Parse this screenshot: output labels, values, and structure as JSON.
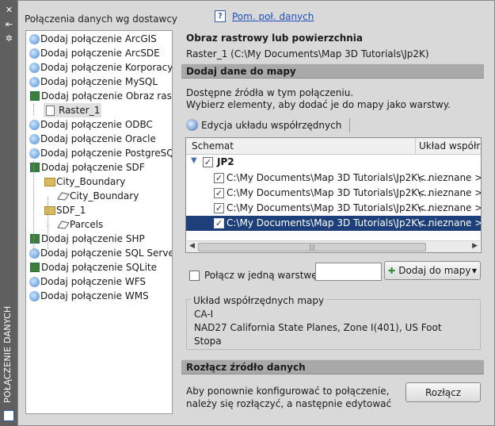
{
  "palette": {
    "title": "POŁĄCZENIE DANYCH",
    "buttons": [
      "close-icon",
      "pin-icon",
      "properties-icon"
    ]
  },
  "left_panel": {
    "title": "Połączenia danych wg dostawcy",
    "tree": [
      {
        "label": "Dodaj połączenie ArcGIS",
        "icon": "globe-icon",
        "level": 0
      },
      {
        "label": "Dodaj połączenie ArcSDE",
        "icon": "globe-icon",
        "level": 0
      },
      {
        "label": "Dodaj połączenie Korporacyjne",
        "icon": "globe-icon",
        "level": 0
      },
      {
        "label": "Dodaj połączenie MySQL",
        "icon": "globe-icon",
        "level": 0
      },
      {
        "label": "Dodaj połączenie Obraz rastrowy",
        "icon": "raster-icon",
        "level": 0
      },
      {
        "label": "Raster_1",
        "icon": "page-icon",
        "level": 1,
        "selected": true
      },
      {
        "label": "Dodaj połączenie ODBC",
        "icon": "globe-icon",
        "level": 0
      },
      {
        "label": "Dodaj połączenie Oracle",
        "icon": "globe-icon",
        "level": 0
      },
      {
        "label": "Dodaj połączenie PostgreSQL",
        "icon": "globe-icon",
        "level": 0
      },
      {
        "label": "Dodaj połączenie SDF",
        "icon": "raster-icon",
        "level": 0
      },
      {
        "label": "City_Boundary",
        "icon": "folder-icon",
        "level": 1
      },
      {
        "label": "City_Boundary",
        "icon": "polygon-icon",
        "level": 2
      },
      {
        "label": "SDF_1",
        "icon": "folder-icon",
        "level": 1
      },
      {
        "label": "Parcels",
        "icon": "polygon-icon",
        "level": 2
      },
      {
        "label": "Dodaj połączenie SHP",
        "icon": "raster-icon",
        "level": 0
      },
      {
        "label": "Dodaj połączenie SQL Server Spatial",
        "icon": "globe-icon",
        "level": 0
      },
      {
        "label": "Dodaj połączenie SQLite",
        "icon": "raster-icon",
        "level": 0
      },
      {
        "label": "Dodaj połączenie WFS",
        "icon": "globe-icon",
        "level": 0
      },
      {
        "label": "Dodaj połączenie WMS",
        "icon": "globe-icon",
        "level": 0
      }
    ]
  },
  "right_panel": {
    "help_link": "Pom. poł. danych",
    "heading": "Obraz rastrowy lub powierzchnia",
    "connection_path": "Raster_1 (C:\\My Documents\\Map 3D Tutorials\\Jp2K)",
    "add_section_title": "Dodaj dane do mapy",
    "info_line1": "Dostępne źródła w tym połączeniu.",
    "info_line2": "Wybierz elementy, aby dodać je do mapy jako warstwy.",
    "toolbar_button": "Edycja układu współrzędnych",
    "grid": {
      "col_schema": "Schemat",
      "col_coord": "Układ współrzędnych",
      "group": "JP2",
      "rows": [
        {
          "path": "C:\\My Documents\\Map 3D Tutorials\\Jp2K\\...",
          "coord": "< nieznane >",
          "checked": true
        },
        {
          "path": "C:\\My Documents\\Map 3D Tutorials\\Jp2K\\...",
          "coord": "< nieznane >",
          "checked": true
        },
        {
          "path": "C:\\My Documents\\Map 3D Tutorials\\Jp2K\\...",
          "coord": "< nieznane >",
          "checked": true
        },
        {
          "path": "C:\\My Documents\\Map 3D Tutorials\\Jp2K\\...",
          "coord": "< nieznane >",
          "checked": true,
          "selected": true
        }
      ]
    },
    "merge_label": "Połącz w jedną warstwę:",
    "merge_value": "",
    "add_to_map_button": "Dodaj do mapy",
    "coord_group_title": "Układ współrzędnych mapy",
    "coord_code": "CA-I",
    "coord_desc_line1": "NAD27 California State Planes, Zone I(401), US Foot",
    "coord_desc_line2": "Stopa",
    "disconnect_title": "Rozłącz źródło danych",
    "disconnect_text1": "Aby ponownie konfigurować to połączenie,",
    "disconnect_text2": "należy się rozłączyć, a następnie edytować",
    "disconnect_button": "Rozłącz"
  }
}
